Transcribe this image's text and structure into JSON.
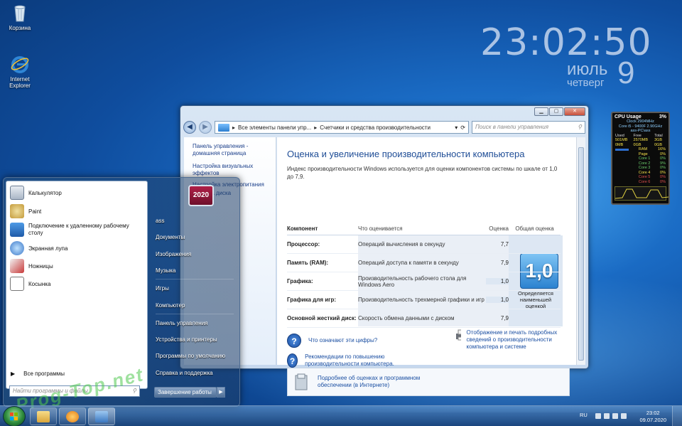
{
  "desktop": {
    "icons": [
      {
        "label": "Корзина",
        "icon": "recycle-bin-icon"
      },
      {
        "label": "Internet Explorer",
        "icon": "internet-explorer-icon"
      }
    ],
    "watermark": "Prog-Top.net"
  },
  "clock": {
    "time": "23:02:50",
    "month": "июль",
    "day": "9",
    "weekday": "четверг"
  },
  "cpu_gadget": {
    "title": "CPU Usage",
    "usage": "3%",
    "clock": "Clock 2904MHz",
    "cpu_name": "Core i5 - 9400F 2.90GHz",
    "host": "ass-PC\\ass",
    "mem_headers": [
      "Used",
      "Free",
      "Total"
    ],
    "mem_values": [
      "501MB",
      "2570MB",
      "3GB"
    ],
    "page_values": [
      "0MB",
      "0GB",
      "0GB"
    ],
    "rows": [
      {
        "name": "RAM",
        "value": "16%"
      },
      {
        "name": "Page",
        "value": "0%"
      },
      {
        "name": "Core 1",
        "value": "0%"
      },
      {
        "name": "Core 2",
        "value": "9%"
      },
      {
        "name": "Core 3",
        "value": "0%"
      },
      {
        "name": "Core 4",
        "value": "0%"
      },
      {
        "name": "Core 5",
        "value": "0%"
      },
      {
        "name": "Core 6",
        "value": "0%"
      }
    ],
    "accent": "#f5e14a"
  },
  "window": {
    "address_parts": [
      "Все элементы панели упр...",
      "Счетчики и средства производительности"
    ],
    "search_placeholder": "Поиск в панели управления",
    "left_pane": [
      "Панель управления - домашняя страница",
      "Настройка визуальных эффектов",
      "Настройка электропитания",
      "Очистка диска"
    ],
    "title": "Оценка и увеличение производительности компьютера",
    "description": "Индекс производительности Windows используется для оценки компонентов системы по шкале от 1,0 до 7,9.",
    "table_headers": [
      "Компонент",
      "Что оценивается",
      "Оценка",
      "Общая оценка"
    ],
    "rows": [
      {
        "component": "Процессор:",
        "what": "Операций вычисления в секунду",
        "score": "7,7"
      },
      {
        "component": "Память (RAM):",
        "what": "Операций доступа к памяти в секунду",
        "score": "7,9"
      },
      {
        "component": "Графика:",
        "what": "Производительность рабочего стола для Windows Aero",
        "score": "1,0"
      },
      {
        "component": "Графика для игр:",
        "what": "Производительность трехмерной графики и игр",
        "score": "1,0"
      },
      {
        "component": "Основной жесткий диск:",
        "what": "Скорость обмена данными с диском",
        "score": "7,9"
      }
    ],
    "base_score": "1,0",
    "base_score_label": "Определяется наименьшей оценкой",
    "links": {
      "what_means": "Что означают эти цифры?",
      "print": "Отображение и печать подробных сведений о производительности компьютера и системе",
      "tips": "Рекомендации по повышению производительности компьютера.",
      "more_info": "Подробнее об оценках и программном обеспечении (в Интернете)"
    }
  },
  "start_menu": {
    "programs": [
      {
        "label": "Калькулятор",
        "icon": "calculator-icon"
      },
      {
        "label": "Paint",
        "icon": "paint-icon"
      },
      {
        "label": "Подключение к удаленному рабочему столу",
        "icon": "remote-desktop-icon"
      },
      {
        "label": "Экранная лупа",
        "icon": "magnifier-icon"
      },
      {
        "label": "Ножницы",
        "icon": "snipping-tool-icon"
      },
      {
        "label": "Косынка",
        "icon": "solitaire-icon"
      }
    ],
    "all_programs": "Все программы",
    "search_placeholder": "Найти программы и файлы",
    "user_pic_text": "2020",
    "right_items": [
      "ass",
      "Документы",
      "Изображения",
      "Музыка",
      "Игры",
      "Компьютер",
      "Панель управления",
      "Устройства и принтеры",
      "Программы по умолчанию",
      "Справка и поддержка"
    ],
    "shutdown": "Завершение работы"
  },
  "taskbar": {
    "lang": "RU",
    "time": "23:02",
    "date": "09.07.2020"
  }
}
